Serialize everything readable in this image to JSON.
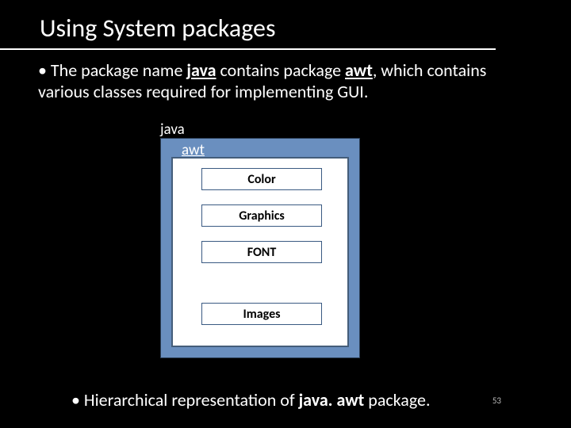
{
  "title": "Using System packages",
  "bullet1": {
    "prefix": "• The package name ",
    "w1": "java",
    "mid": " contains package ",
    "w2": "awt",
    "suffix": ", which contains various classes required for implementing GUI."
  },
  "diagram": {
    "outer_label": "java",
    "inner_label": "awt",
    "items": [
      "Color",
      "Graphics",
      "FONT",
      "Images"
    ]
  },
  "bullet2": {
    "prefix": "• Hierarchical representation of ",
    "bold": "java. awt",
    "suffix": " package."
  },
  "page": "53"
}
